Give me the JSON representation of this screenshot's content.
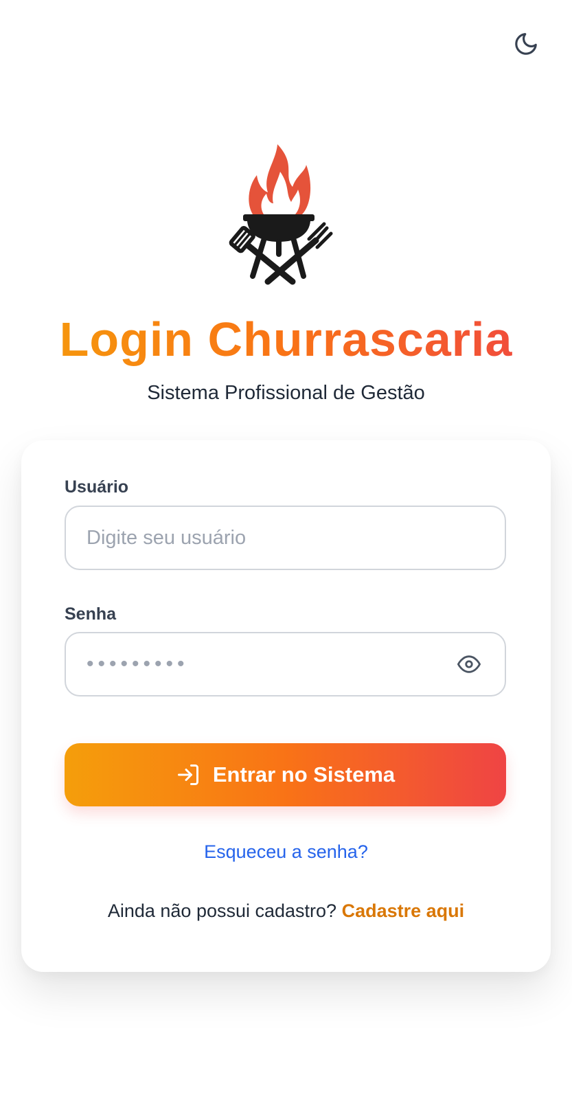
{
  "header": {
    "theme_toggle_icon": "moon-icon"
  },
  "brand": {
    "logo_icon": "grill-flame-icon",
    "title": "Login Churrascaria",
    "subtitle": "Sistema Profissional de Gestão",
    "gradient_colors": [
      "#f59e0b",
      "#f97316",
      "#ef4444"
    ]
  },
  "form": {
    "username": {
      "label": "Usuário",
      "placeholder": "Digite seu usuário",
      "value": ""
    },
    "password": {
      "label": "Senha",
      "masked_value": "•••••••••",
      "toggle_icon": "eye-icon"
    },
    "submit": {
      "label": "Entrar no Sistema",
      "icon": "login-arrow-icon"
    },
    "forgot_password_label": "Esqueceu a senha?",
    "signup": {
      "prompt": "Ainda não possui cadastro?",
      "link_label": "Cadastre aqui"
    }
  },
  "colors": {
    "link_blue": "#2563eb",
    "link_orange": "#d97706",
    "border": "#d1d5db",
    "text_dark": "#1f2937"
  }
}
